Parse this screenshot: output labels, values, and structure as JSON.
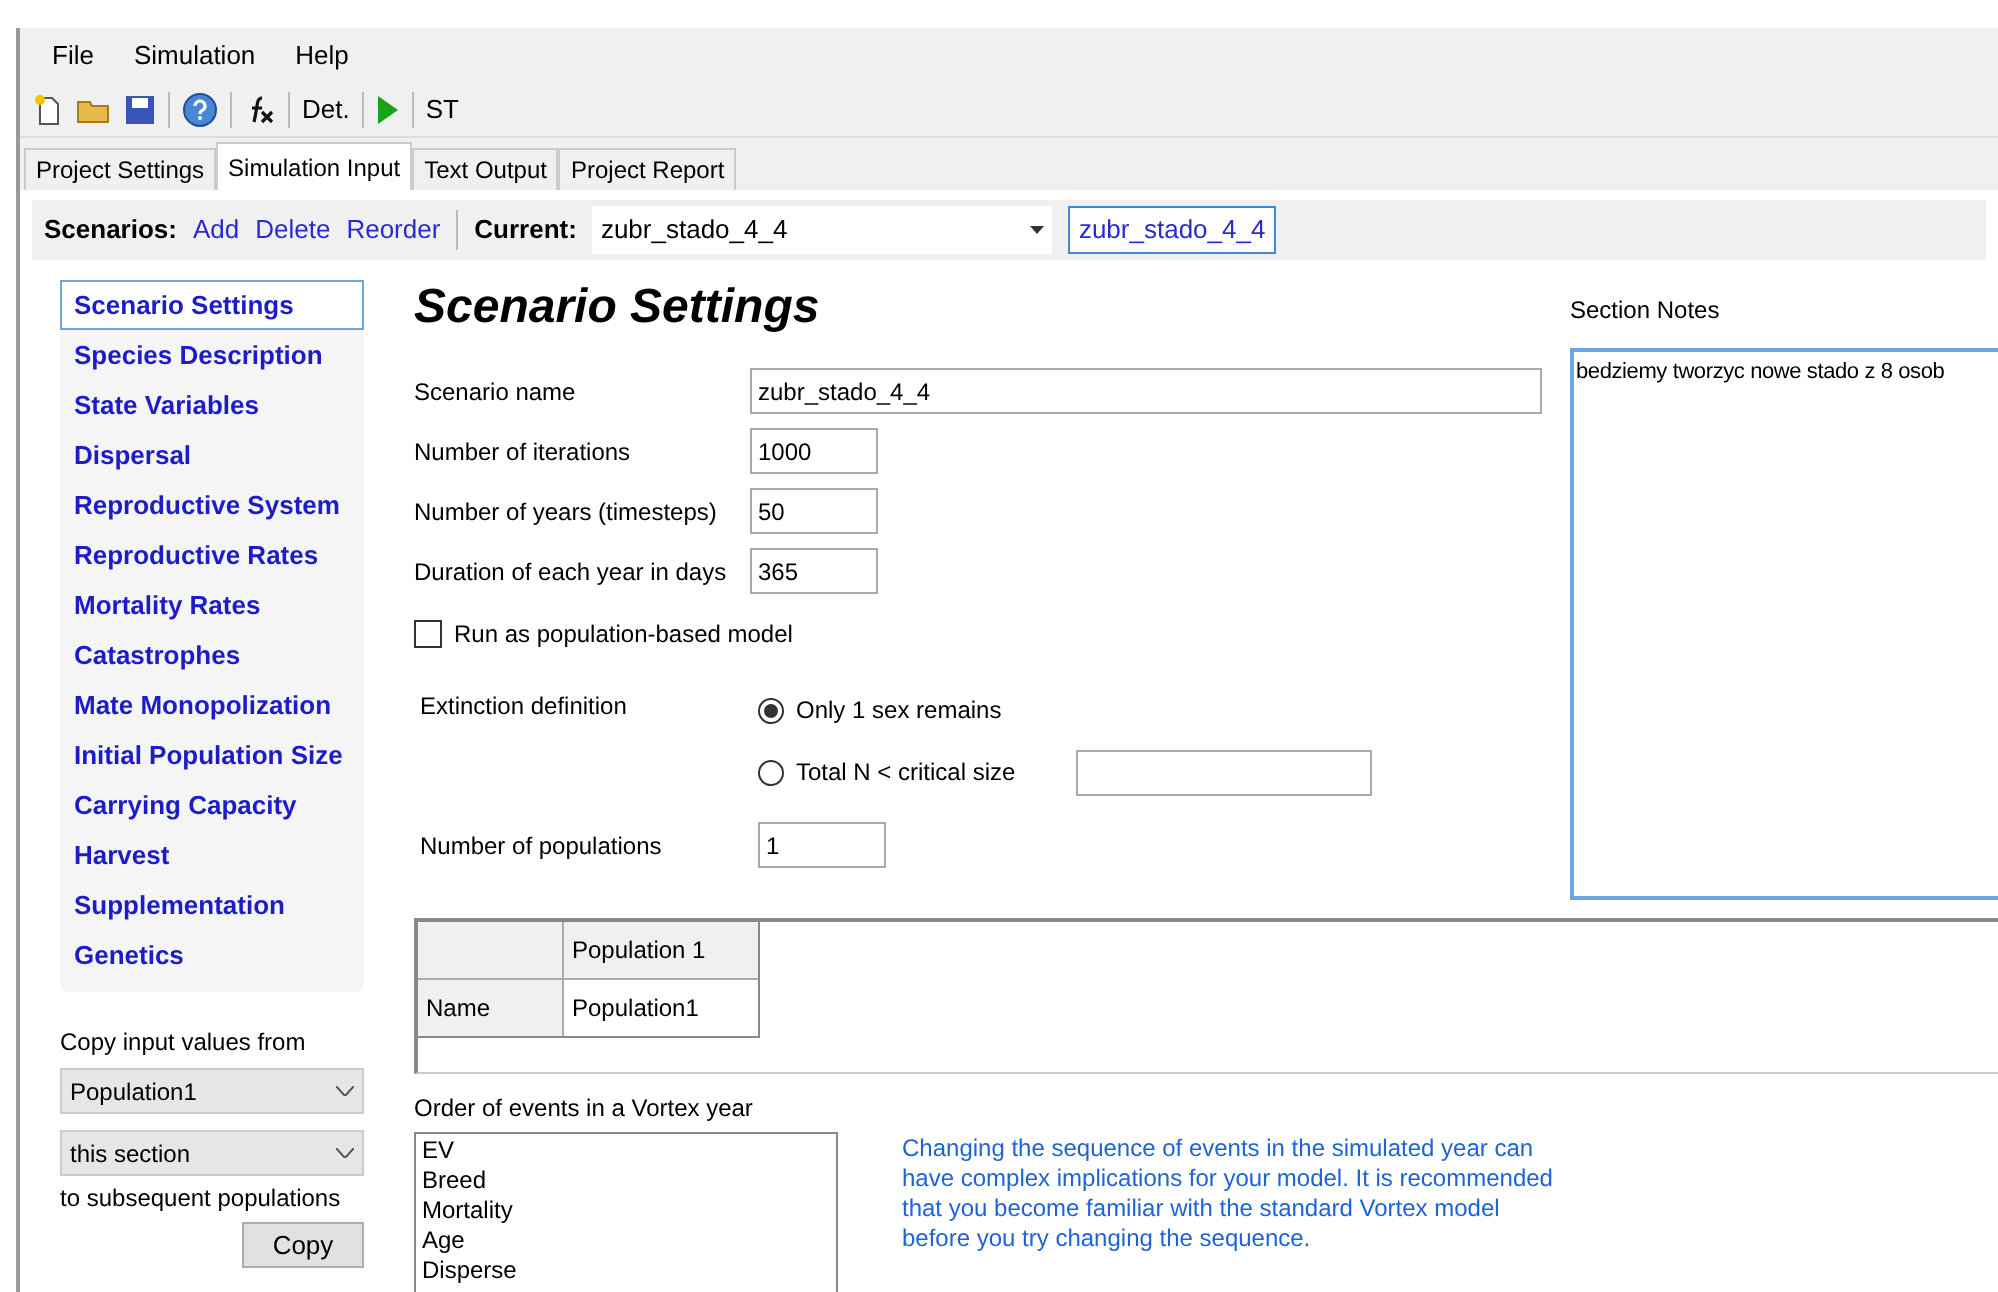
{
  "menu": [
    "File",
    "Simulation",
    "Help"
  ],
  "toolbar": {
    "det_label": "Det.",
    "st_label": "ST"
  },
  "tabs": [
    {
      "label": "Project Settings",
      "selected": false
    },
    {
      "label": "Simulation Input",
      "selected": true
    },
    {
      "label": "Text Output",
      "selected": false
    },
    {
      "label": "Project Report",
      "selected": false
    }
  ],
  "scenarios": {
    "label": "Scenarios:",
    "actions": [
      "Add",
      "Delete",
      "Reorder"
    ],
    "current_label": "Current:",
    "current_value": "zubr_stado_4_4",
    "current_badge": "zubr_stado_4_4"
  },
  "sidebar": {
    "items": [
      {
        "label": "Scenario Settings",
        "selected": true
      },
      {
        "label": "Species Description",
        "selected": false
      },
      {
        "label": "State Variables",
        "selected": false
      },
      {
        "label": "Dispersal",
        "selected": false
      },
      {
        "label": "Reproductive System",
        "selected": false
      },
      {
        "label": "Reproductive Rates",
        "selected": false
      },
      {
        "label": "Mortality Rates",
        "selected": false
      },
      {
        "label": "Catastrophes",
        "selected": false
      },
      {
        "label": "Mate Monopolization",
        "selected": false
      },
      {
        "label": "Initial Population Size",
        "selected": false
      },
      {
        "label": "Carrying Capacity",
        "selected": false
      },
      {
        "label": "Harvest",
        "selected": false
      },
      {
        "label": "Supplementation",
        "selected": false
      },
      {
        "label": "Genetics",
        "selected": false
      }
    ]
  },
  "copy_panel": {
    "label": "Copy input values from",
    "source": "Population1",
    "section": "this section",
    "suffix": "to subsequent populations",
    "button": "Copy"
  },
  "page_title": "Scenario Settings",
  "fields": [
    {
      "label": "Scenario name",
      "value": "zubr_stado_4_4",
      "kind": "wide"
    },
    {
      "label": "Number of iterations",
      "value": "1000",
      "kind": "short"
    },
    {
      "label": "Number of years (timesteps)",
      "value": "50",
      "kind": "short"
    },
    {
      "label": "Duration of each year in days",
      "value": "365",
      "kind": "short"
    }
  ],
  "population_model": {
    "label": "Run as population-based model",
    "checked": false
  },
  "extinction": {
    "label": "Extinction definition",
    "options": [
      {
        "label": "Only 1 sex remains",
        "selected": true
      },
      {
        "label": "Total N < critical size",
        "selected": false
      }
    ]
  },
  "populations": {
    "label": "Number of populations",
    "value": "1"
  },
  "table": {
    "columns": [
      "Population 1"
    ],
    "rows": [
      {
        "label": "Name",
        "value": "Population1"
      }
    ]
  },
  "order": {
    "label": "Order of events in a Vortex year",
    "events": [
      "EV",
      "Breed",
      "Mortality",
      "Age",
      "Disperse"
    ]
  },
  "info_text": "Changing the sequence of events in the simulated year  can have complex implications for your model. It is recommended that you become familiar with the standard Vortex model before you try changing the sequence.",
  "notes": {
    "label": "Section Notes",
    "text": "bedziemy tworzyc nowe stado z 8 osob"
  }
}
